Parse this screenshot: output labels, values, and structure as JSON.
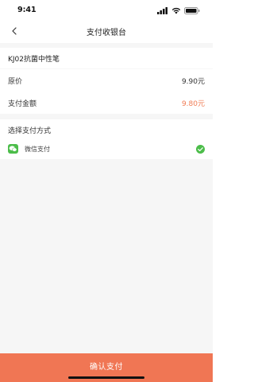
{
  "status_bar": {
    "time": "9:41",
    "icons": [
      "signal-icon",
      "wifi-icon",
      "battery-icon"
    ]
  },
  "nav": {
    "back_icon": "chevron-left-icon",
    "title": "支付收银台"
  },
  "product": {
    "name": "KJ02抗菌中性笔"
  },
  "price": {
    "original_label": "原价",
    "original_value": "9.90元",
    "pay_label": "支付金额",
    "pay_value": "9.80元"
  },
  "payment": {
    "header": "选择支付方式",
    "options": [
      {
        "label": "微信支付",
        "icon": "wechat-icon",
        "selected": true
      }
    ]
  },
  "footer": {
    "confirm_label": "确认支付"
  },
  "colors": {
    "accent": "#f07654",
    "price_accent": "#f07c54",
    "wechat_green": "#4cbd4a"
  }
}
